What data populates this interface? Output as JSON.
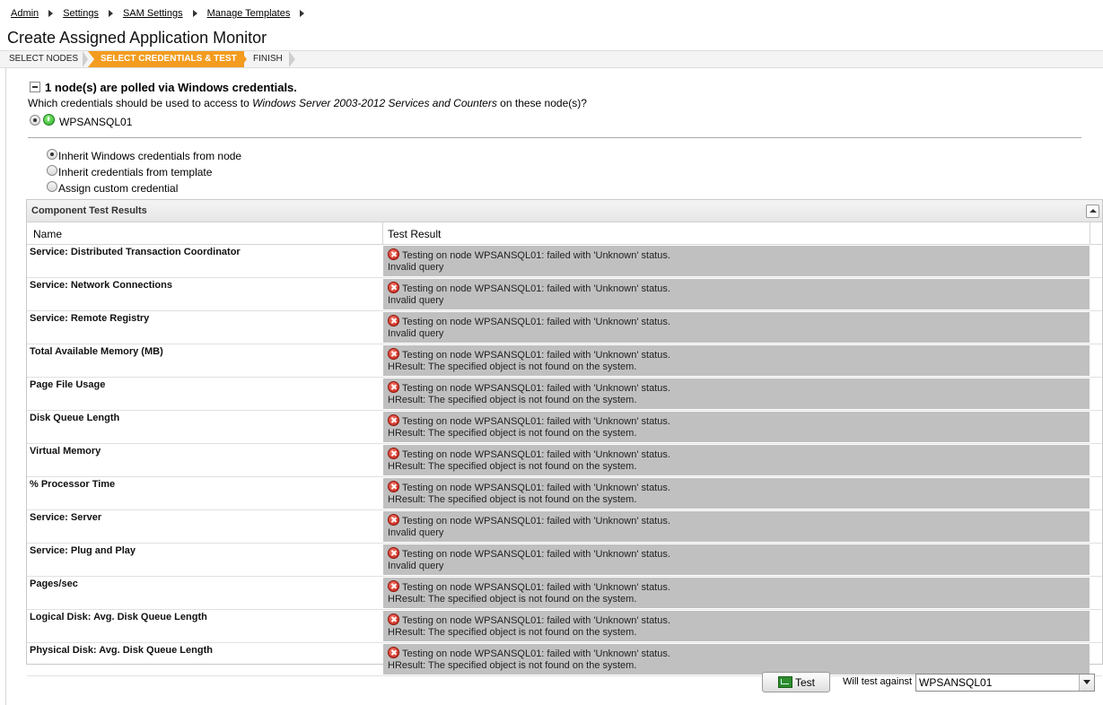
{
  "breadcrumb": [
    "Admin",
    "Settings",
    "SAM Settings",
    "Manage Templates"
  ],
  "page_title": "Create Assigned Application Monitor",
  "wizard": {
    "steps": [
      "SELECT NODES",
      "SELECT CREDENTIALS & TEST",
      "FINISH"
    ],
    "active_step": 1,
    "active_color": "#f39c1f"
  },
  "polled": {
    "heading": "1 node(s) are polled via Windows credentials.",
    "question_prefix": "Which credentials should be used to access to ",
    "question_template": "Windows Server 2003-2012 Services and Counters",
    "question_suffix": " on these node(s)?",
    "node_name": "WPSANSQL01",
    "node_status": "up"
  },
  "credential_options": [
    {
      "label": "Inherit Windows credentials from node",
      "checked": true
    },
    {
      "label": "Inherit credentials from template",
      "checked": false
    },
    {
      "label": "Assign custom credential",
      "checked": false
    }
  ],
  "results_panel": {
    "title": "Component Test Results",
    "columns": [
      "Name",
      "Test Result"
    ],
    "rows": [
      {
        "name": "Service: Distributed Transaction Coordinator",
        "line1": "Testing on node WPSANSQL01: failed with 'Unknown' status.",
        "line2": "Invalid query"
      },
      {
        "name": "Service: Network Connections",
        "line1": "Testing on node WPSANSQL01: failed with 'Unknown' status.",
        "line2": "Invalid query"
      },
      {
        "name": "Service: Remote Registry",
        "line1": "Testing on node WPSANSQL01: failed with 'Unknown' status.",
        "line2": "Invalid query"
      },
      {
        "name": "Total Available Memory (MB)",
        "line1": "Testing on node WPSANSQL01: failed with 'Unknown' status.",
        "line2": "HResult: The specified object is not found on the system."
      },
      {
        "name": "Page File Usage",
        "line1": "Testing on node WPSANSQL01: failed with 'Unknown' status.",
        "line2": "HResult: The specified object is not found on the system."
      },
      {
        "name": "Disk Queue Length",
        "line1": "Testing on node WPSANSQL01: failed with 'Unknown' status.",
        "line2": "HResult: The specified object is not found on the system."
      },
      {
        "name": "Virtual Memory",
        "line1": "Testing on node WPSANSQL01: failed with 'Unknown' status.",
        "line2": "HResult: The specified object is not found on the system."
      },
      {
        "name": "% Processor Time",
        "line1": "Testing on node WPSANSQL01: failed with 'Unknown' status.",
        "line2": "HResult: The specified object is not found on the system."
      },
      {
        "name": "Service: Server",
        "line1": "Testing on node WPSANSQL01: failed with 'Unknown' status.",
        "line2": "Invalid query"
      },
      {
        "name": "Service: Plug and Play",
        "line1": "Testing on node WPSANSQL01: failed with 'Unknown' status.",
        "line2": "Invalid query"
      },
      {
        "name": "Pages/sec",
        "line1": "Testing on node WPSANSQL01: failed with 'Unknown' status.",
        "line2": "HResult: The specified object is not found on the system."
      },
      {
        "name": "Logical Disk: Avg. Disk Queue Length",
        "line1": "Testing on node WPSANSQL01: failed with 'Unknown' status.",
        "line2": "HResult: The specified object is not found on the system."
      },
      {
        "name": "Physical Disk: Avg. Disk Queue Length",
        "line1": "Testing on node WPSANSQL01: failed with 'Unknown' status.",
        "line2": "HResult: The specified object is not found on the system."
      }
    ]
  },
  "footer": {
    "test_button_label": "Test",
    "will_test_label": "Will test against",
    "selected_node": "WPSANSQL01"
  },
  "icons": {
    "error": "error-x-icon",
    "node_status": "node-up-icon",
    "test": "test-monitor-icon"
  }
}
